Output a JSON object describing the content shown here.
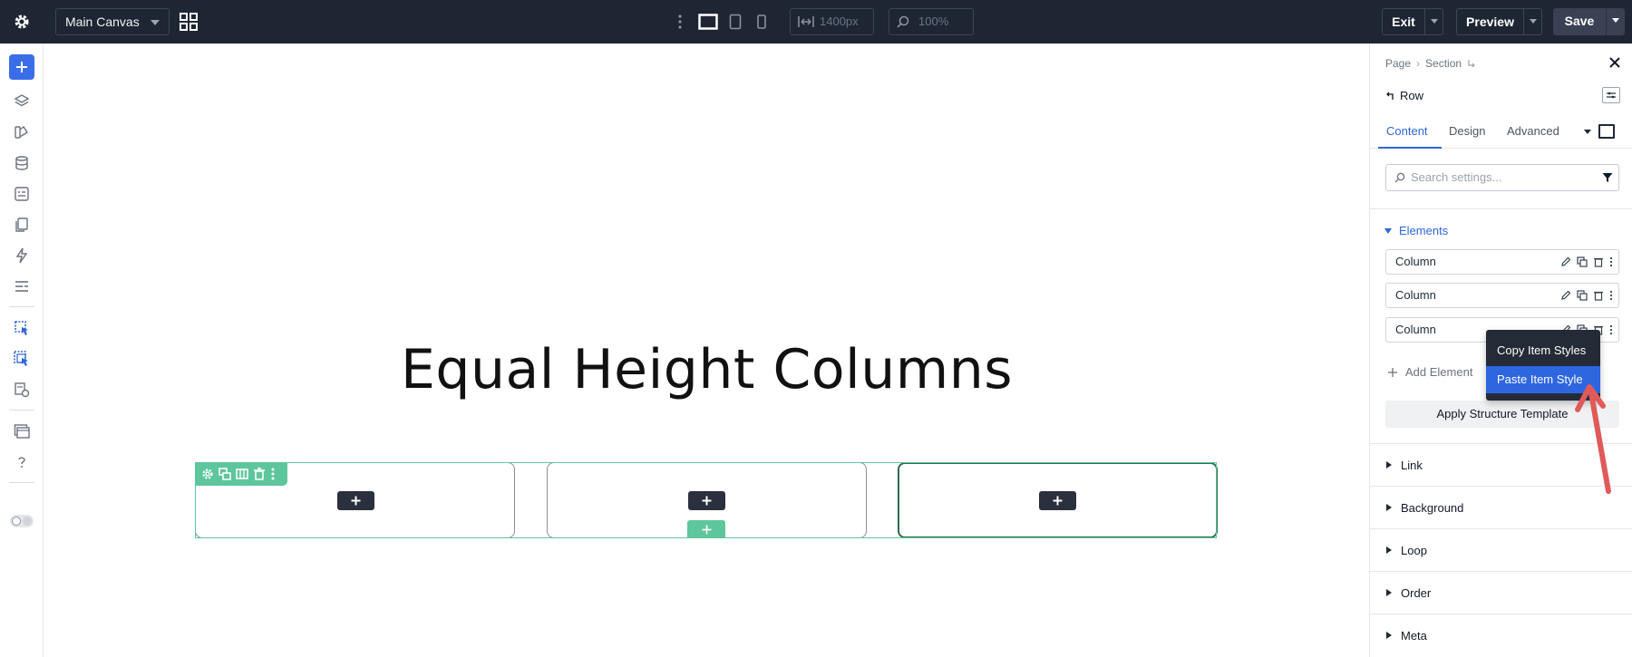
{
  "topbar": {
    "canvas_select": "Main Canvas",
    "width_value": "1400px",
    "zoom_value": "100%",
    "exit_label": "Exit",
    "preview_label": "Preview",
    "save_label": "Save"
  },
  "canvas": {
    "heading": "Equal Height Columns",
    "columns": 3
  },
  "panel": {
    "breadcrumb": [
      "Page",
      "Section"
    ],
    "element_name": "Row",
    "tabs": [
      "Content",
      "Design",
      "Advanced"
    ],
    "active_tab": "Content",
    "search_placeholder": "Search settings...",
    "elements_section": "Elements",
    "element_items": [
      "Column",
      "Column",
      "Column"
    ],
    "add_element": "Add Element",
    "apply_template": "Apply Structure Template",
    "groups": [
      "Link",
      "Background",
      "Loop",
      "Order",
      "Meta"
    ]
  },
  "context_menu": {
    "copy": "Copy Item Styles",
    "paste": "Paste Item Style"
  },
  "colors": {
    "topbar_bg": "#1e2533",
    "accent_blue": "#2e66d9",
    "row_green": "#5ec69c",
    "arrow_red": "#e05a5a"
  }
}
